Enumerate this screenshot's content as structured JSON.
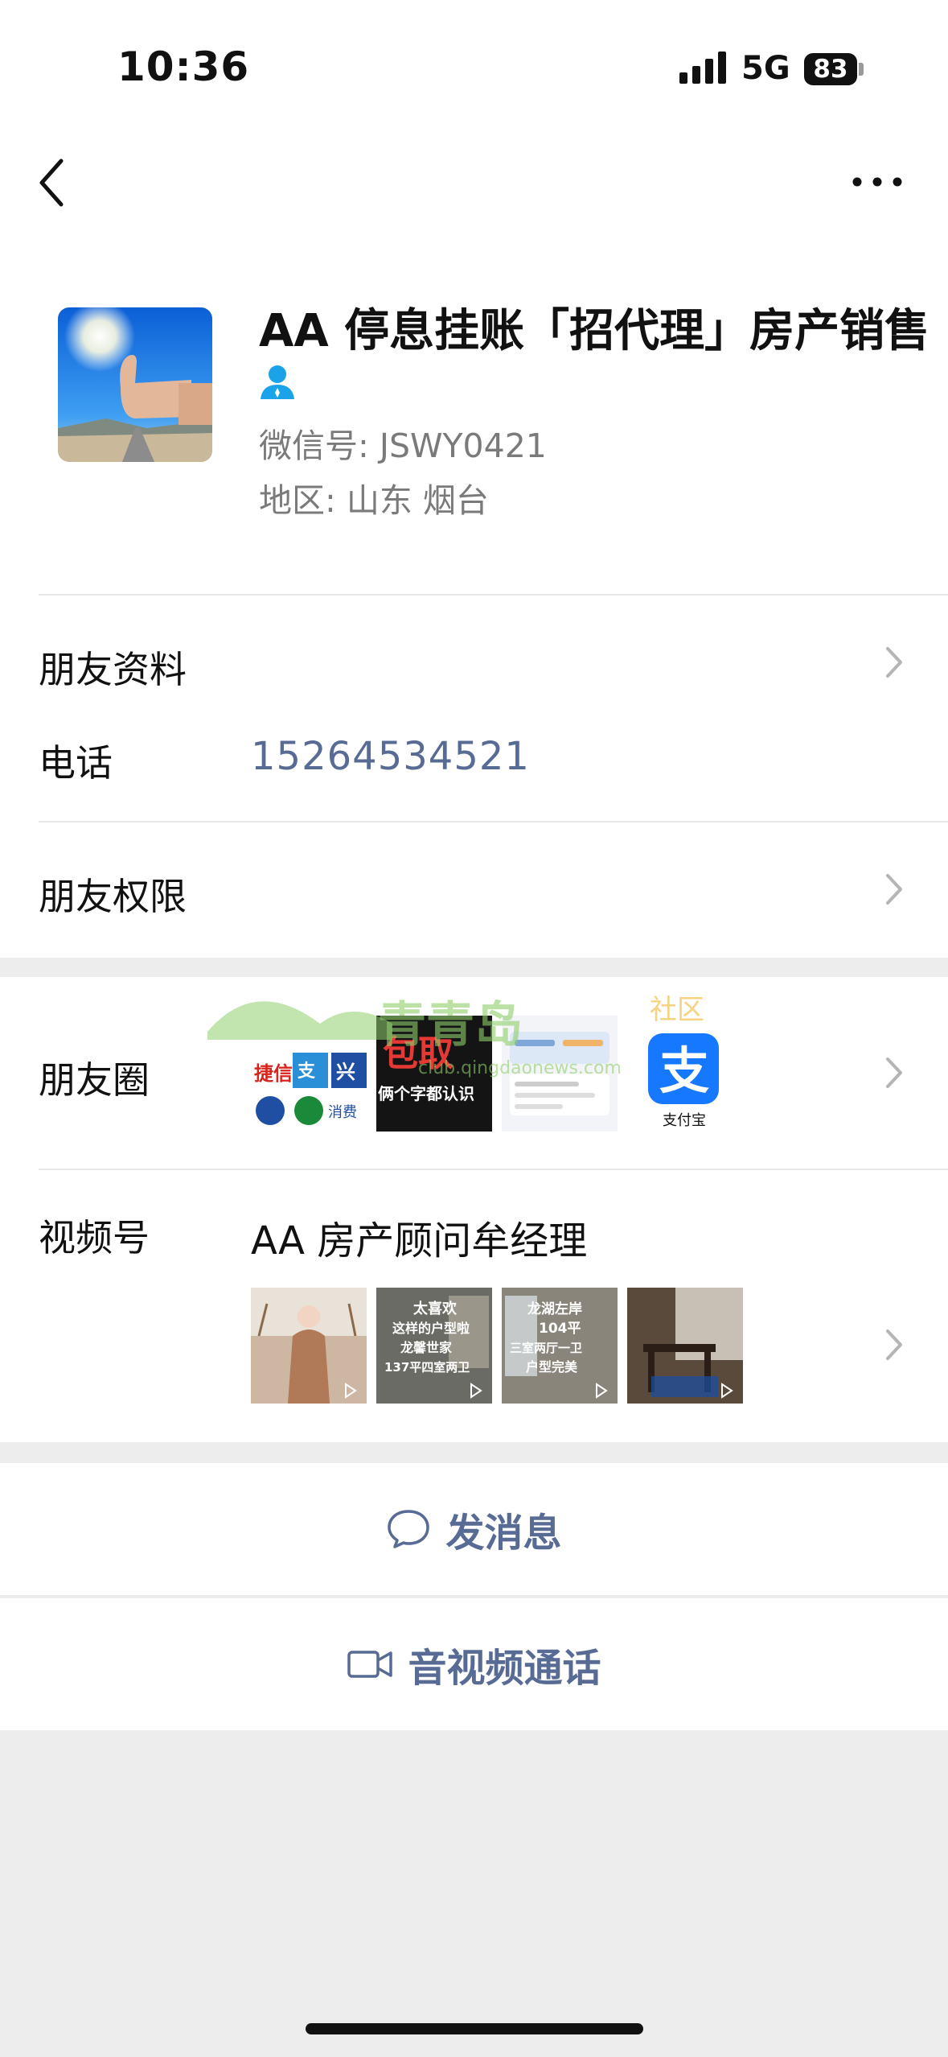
{
  "status_bar": {
    "time": "10:36",
    "network": "5G",
    "battery": "83"
  },
  "nav": {
    "back_icon": "chevron-left-icon",
    "more_icon": "ellipsis-icon"
  },
  "profile": {
    "name": "AA 停息挂账「招代理」房产销售",
    "wechat_id": "微信号: JSWY0421",
    "region": "地区: 山东 烟台",
    "person_icon_color": "#1aa3e8"
  },
  "rows": {
    "friend_info": "朋友资料",
    "phone_label": "电话",
    "phone_value": "15264534521",
    "permissions": "朋友权限",
    "moments": "朋友圈",
    "channels": "视频号",
    "channels_title": "AA 房产顾问牟经理"
  },
  "moments_thumbs": [
    {
      "text": "捷信 / 消费金融 / 消费贷",
      "bg": "#ffffff"
    },
    {
      "text": "包取 俩个字都认识",
      "bg": "#141414"
    },
    {
      "text": "",
      "bg": "#f2f4f7"
    },
    {
      "text": "支付宝",
      "bg": "#ffffff"
    }
  ],
  "video_thumbs": [
    {
      "text": "",
      "bg": "#c9a98c"
    },
    {
      "text": "太喜欢 这样的户型啦 龙馨世家 137平四室两卫",
      "bg": "#5b5b5b"
    },
    {
      "text": "龙湖左岸 104平 三室两厅一卫 户型完美",
      "bg": "#7a7468"
    },
    {
      "text": "",
      "bg": "#4a3a2e"
    }
  ],
  "watermark": {
    "brand": "青青岛",
    "suffix": "社区",
    "url": "club.qingdaonews.com"
  },
  "actions": {
    "message": "发消息",
    "call": "音视频通话"
  },
  "colors": {
    "link": "#576b95",
    "background": "#ededed",
    "alipay": "#1677ff"
  }
}
